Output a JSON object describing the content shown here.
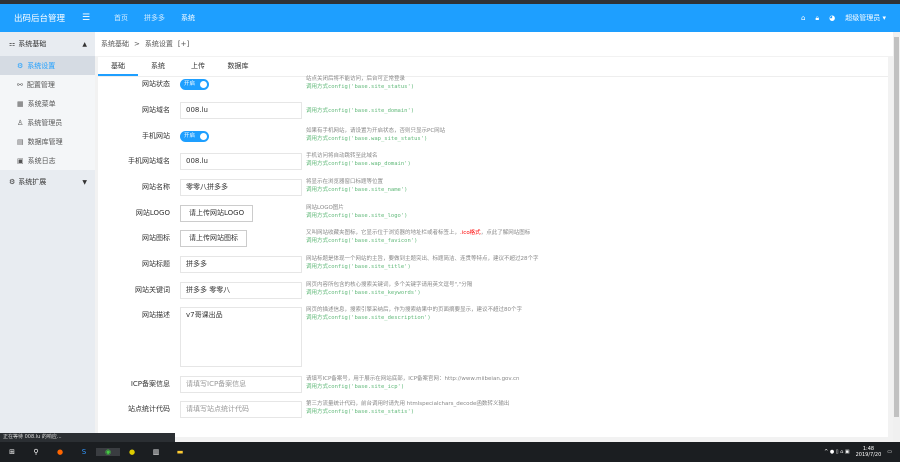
{
  "header": {
    "title": "出码后台管理",
    "nav": [
      "首页",
      "拼多多",
      "系统"
    ],
    "user": "超级管理员"
  },
  "sidebar": {
    "group1": "系统基础",
    "items": [
      "系统设置",
      "配置管理",
      "系统菜单",
      "系统管理员",
      "数据库管理",
      "系统日志"
    ],
    "group2": "系统扩展"
  },
  "breadcrumb": {
    "items": [
      "系统基础",
      ">",
      "系统设置",
      "[+]"
    ]
  },
  "tabs": [
    "基础",
    "系统",
    "上传",
    "数据库"
  ],
  "form": [
    {
      "label": "网站状态",
      "type": "switch",
      "value": "开启",
      "help": "站点关闭后将不能访问，后台可正常登录",
      "code": "调用方式config('base.site_status')"
    },
    {
      "label": "网站域名",
      "type": "input",
      "value": "008.lu",
      "help": "",
      "code": "调用方式config('base.site_domain')"
    },
    {
      "label": "手机网站",
      "type": "switch",
      "value": "开启",
      "help": "如果有手机网站，请设置为开启状态，否则只显示PC网站",
      "code": "调用方式config('base.wap_site_status')"
    },
    {
      "label": "手机网站域名",
      "type": "input",
      "value": "008.lu",
      "help": "手机访问将自动跳转至此域名",
      "code": "调用方式config('base.wap_domain')"
    },
    {
      "label": "网站名称",
      "type": "input",
      "value": "零零八拼多多",
      "help": "将显示在浏览器窗口标题等位置",
      "code": "调用方式config('base.site_name')"
    },
    {
      "label": "网站LOGO",
      "type": "button",
      "value": "请上传网站LOGO",
      "help": "网站LOGO图片",
      "code": "调用方式config('base.site_logo')"
    },
    {
      "label": "网站图标",
      "type": "button",
      "value": "请上传网站图标",
      "help": "又叫网站收藏夹图标，它显示位于浏览器的地址栏或者标签上，",
      "help_red": ".ico格式",
      "help_tail": "，点此了解网站图标",
      "code": "调用方式config('base.site_favicon')"
    },
    {
      "label": "网站标题",
      "type": "input",
      "value": "拼多多",
      "help": "网站标题是体现一个网站的主旨，要做到主题突出、标题简洁、连贯等特点，建议不超过28个字",
      "code": "调用方式config('base.site_title')"
    },
    {
      "label": "网站关键词",
      "type": "input",
      "value": "拼多多 零零八",
      "help": "网页内容所包含的核心搜索关键词，多个关键字请用英文逗号\",\"分隔",
      "code": "调用方式config('base.site_keywords')"
    },
    {
      "label": "网站描述",
      "type": "textarea",
      "value": "v7哥课出品",
      "help": "网页的描述信息，搜索引擎采纳后，作为搜索结果中的页面摘要显示，建议不超过80个字",
      "code": "调用方式config('base.site_description')"
    },
    {
      "label": "ICP备案信息",
      "type": "input",
      "placeholder": "请填写ICP备案信息",
      "help": "请填写ICP备案号，用于展示在网站底部，ICP备案官网：http://www.miibeian.gov.cn",
      "code": "调用方式config('base.site_icp')"
    },
    {
      "label": "站点统计代码",
      "type": "input",
      "placeholder": "请填写站点统计代码",
      "help": "第三方流量统计代码，前台调用时请先用 htmlspecialchars_decode函数转义输出",
      "code": "调用方式config('base.site_statis')"
    }
  ],
  "status_text": "正在等待 008.lu 的响应...",
  "taskbar": {
    "time": "1:48",
    "date": "2019/7/20"
  }
}
